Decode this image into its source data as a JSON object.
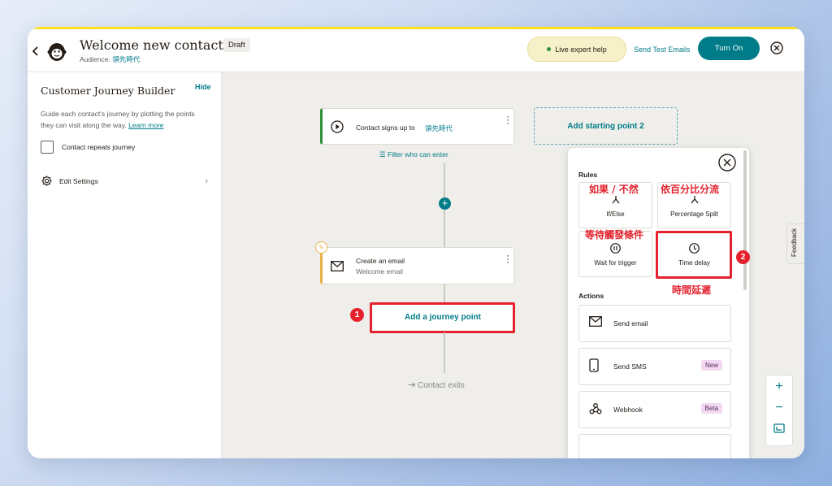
{
  "header": {
    "back_icon": "chevron-left-icon",
    "logo": "mailchimp-freddie-logo",
    "title": "Welcome new contacts",
    "status_badge": "Draft",
    "audience_label": "Audience:",
    "audience_name": "領先時代",
    "live_help": "Live expert help",
    "send_test": "Send Test Emails",
    "turn_on": "Turn On",
    "close_icon": "close-circle-icon"
  },
  "sidebar": {
    "title": "Customer Journey Builder",
    "hide": "Hide",
    "description": "Guide each contact's journey by plotting the points they can visit along the way.",
    "learn_more": "Learn more",
    "repeat_label": "Contact repeats journey",
    "edit_settings": "Edit Settings"
  },
  "canvas": {
    "trigger_text": "Contact signs up to",
    "trigger_audience": "領先時代",
    "add_starting_point": "Add starting point 2",
    "filter": "Filter who can enter",
    "email_title": "Create an email",
    "email_subtitle": "Welcome email",
    "add_journey_point": "Add a journey point",
    "contact_exits": "Contact exits"
  },
  "annotations": {
    "badge1": "1",
    "badge2": "2",
    "if_else_zh": "如果 / 不然",
    "percentage_zh": "依百分比分流",
    "wait_zh": "等待觸發條件",
    "time_delay_zh": "時間延遲",
    "color": "#e4212d"
  },
  "panel": {
    "rules_heading": "Rules",
    "rules": [
      {
        "label": "If/Else",
        "icon": "branch-icon"
      },
      {
        "label": "Percentage Split",
        "icon": "split-icon"
      },
      {
        "label": "Wait for trigger",
        "icon": "pause-icon"
      },
      {
        "label": "Time delay",
        "icon": "clock-icon"
      }
    ],
    "actions_heading": "Actions",
    "actions": [
      {
        "label": "Send email",
        "icon": "envelope-icon",
        "tag": ""
      },
      {
        "label": "Send SMS",
        "icon": "phone-icon",
        "tag": "New"
      },
      {
        "label": "Webhook",
        "icon": "webhook-icon",
        "tag": "Beta"
      }
    ]
  },
  "feedback": "Feedback",
  "colors": {
    "brand": "#007c89",
    "accent_yellow": "#ffe01b",
    "highlight_red": "#e4212d"
  }
}
